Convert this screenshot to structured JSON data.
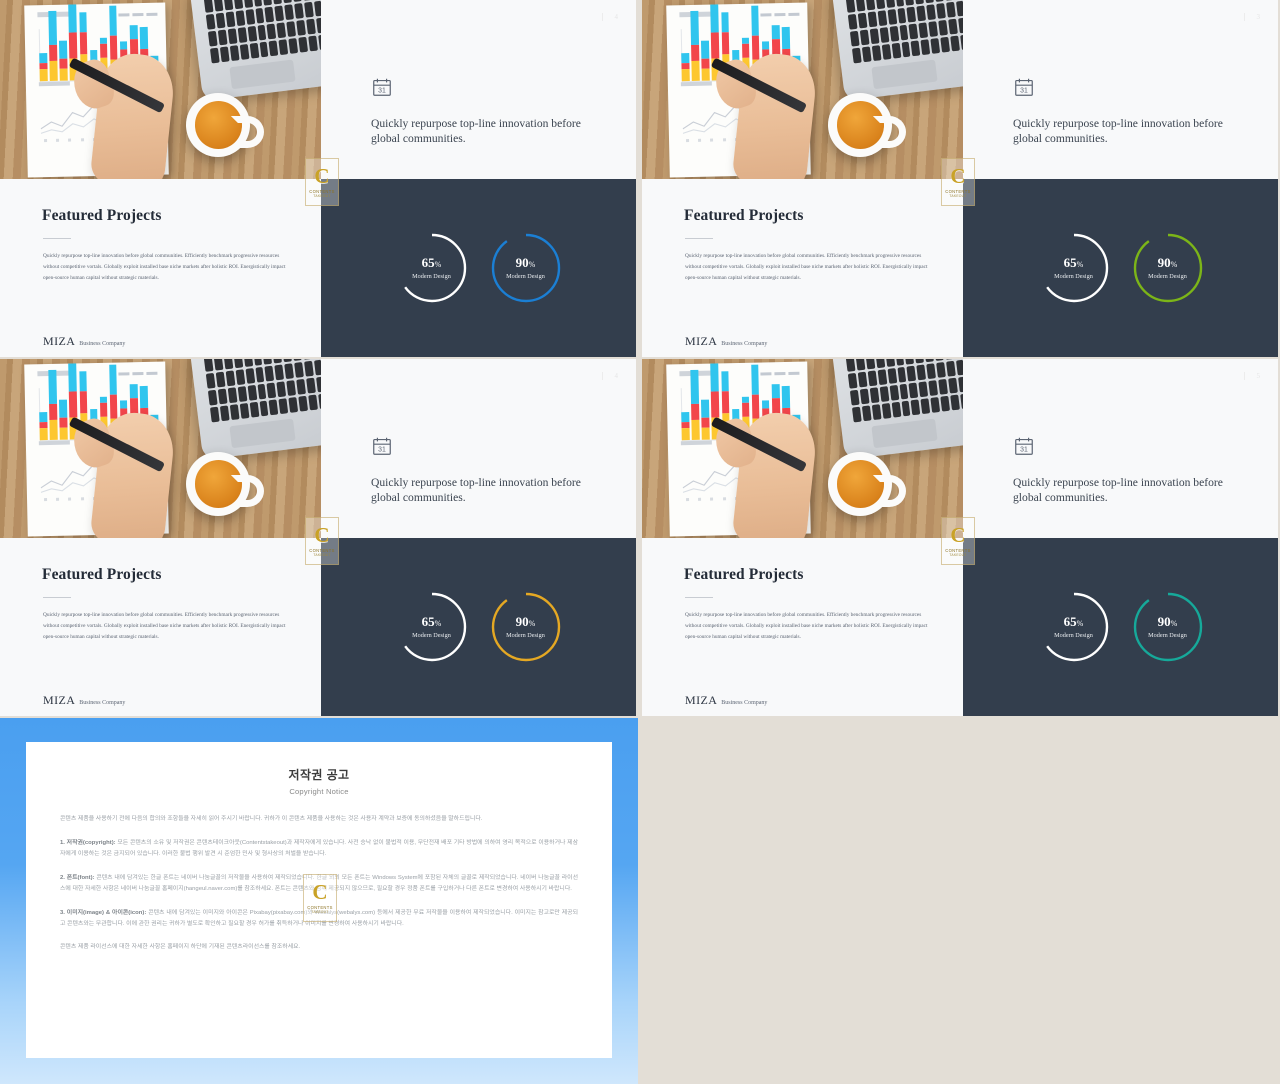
{
  "deck": {
    "slides": [
      {
        "page_number": "4",
        "accent": "#1b7fd4",
        "headline": "Quickly repurpose top-line innovation before global communities.",
        "section_title": "Featured Projects",
        "body": "Quickly repurpose top-line innovation before global communities. Efficiently benchmark progressive resources without competitive vortals. Globally exploit installed base niche markets after holistic ROI. Energistically impact open-source human capital without strategic materials.",
        "logo_mark": "MIZA",
        "logo_sub": "Business Company",
        "calendar_day": "31",
        "donuts": [
          {
            "value": 65,
            "value_label": "65",
            "unit": "%",
            "caption": "Modern Design",
            "color": "#ffffff"
          },
          {
            "value": 90,
            "value_label": "90",
            "unit": "%",
            "caption": "Modern Design",
            "color": "#1b7fd4"
          }
        ]
      },
      {
        "page_number": "3",
        "accent": "#7cb518",
        "headline": "Quickly repurpose top-line innovation before global communities.",
        "section_title": "Featured Projects",
        "body": "Quickly repurpose top-line innovation before global communities. Efficiently benchmark progressive resources without competitive vortals. Globally exploit installed base niche markets after holistic ROI. Energistically impact open-source human capital without strategic materials.",
        "logo_mark": "MIZA",
        "logo_sub": "Business Company",
        "calendar_day": "31",
        "donuts": [
          {
            "value": 65,
            "value_label": "65",
            "unit": "%",
            "caption": "Modern Design",
            "color": "#ffffff"
          },
          {
            "value": 90,
            "value_label": "90",
            "unit": "%",
            "caption": "Modern Design",
            "color": "#7cb518"
          }
        ]
      },
      {
        "page_number": "4",
        "accent": "#e5a823",
        "headline": "Quickly repurpose top-line innovation before global communities.",
        "section_title": "Featured Projects",
        "body": "Quickly repurpose top-line innovation before global communities. Efficiently benchmark progressive resources without competitive vortals. Globally exploit installed base niche markets after holistic ROI. Energistically impact open-source human capital without strategic materials.",
        "logo_mark": "MIZA",
        "logo_sub": "Business Company",
        "calendar_day": "31",
        "donuts": [
          {
            "value": 65,
            "value_label": "65",
            "unit": "%",
            "caption": "Modern Design",
            "color": "#ffffff"
          },
          {
            "value": 90,
            "value_label": "90",
            "unit": "%",
            "caption": "Modern Design",
            "color": "#e5a823"
          }
        ]
      },
      {
        "page_number": "5",
        "accent": "#16a99a",
        "headline": "Quickly repurpose top-line innovation before global communities.",
        "section_title": "Featured Projects",
        "body": "Quickly repurpose top-line innovation before global communities. Efficiently benchmark progressive resources without competitive vortals. Globally exploit installed base niche markets after holistic ROI. Energistically impact open-source human capital without strategic materials.",
        "logo_mark": "MIZA",
        "logo_sub": "Business Company",
        "calendar_day": "31",
        "donuts": [
          {
            "value": 65,
            "value_label": "65",
            "unit": "%",
            "caption": "Modern Design",
            "color": "#ffffff"
          },
          {
            "value": 90,
            "value_label": "90",
            "unit": "%",
            "caption": "Modern Design",
            "color": "#16a99a"
          }
        ]
      }
    ]
  },
  "watermark": {
    "glyph": "C",
    "line1": "CONTENTS",
    "line2": "TAKEOUT"
  },
  "copyright": {
    "title_ko": "저작권 공고",
    "title_en": "Copyright Notice",
    "intro": "콘텐츠 제품을 사용하기 전에 다음의 합의와 조항들을 자세히 읽어 주시기 바랍니다. 귀하가 이 콘텐츠 제품을 사용하는 것은 사용자 계약과 보증에 동의하셨음을 말하드립니다.",
    "p1_label": "1. 저작권(copyright):",
    "p1": "모든 콘텐츠의 소유 및 저작권은 콘텐츠테이크아웃(Contentstakeout)과 제작자에게 있습니다. 사전 승낙 없이 불법적 이용, 무단전재 배포 기타 방법에 의하여 영리 목적으로 이용하거나 제삼자에게 이용하는 것은 금지되어 있습니다. 이러한 불법 행위 발견 시 준엄한 민사 및 형사상의 처벌을 받습니다.",
    "p2_label": "2. 폰트(font):",
    "p2": "콘텐츠 내에 담겨있는 한글 폰트는 네이버 나눔글꼴의 저작물을 사용하여 제작되었습니다. 한글 외의 모든 폰트는 Windows System에 포함된 자체의 글꼴로 제작되었습니다. 네이버 나눔글꼴 라이선스에 대한 자세한 사항은 네이버 나눔글꼴 홈페이지(hangeul.naver.com)를 참조하세요. 폰트는 콘텐츠와 함께 제공되지 않으므로, 필요할 경우 정품 폰트를 구입하거나 다른 폰트로 변경하여 사용하시기 바랍니다.",
    "p3_label": "3. 이미지(image) & 아이콘(icon):",
    "p3": "콘텐츠 내에 담겨있는 이미지와 아이콘은 Pixabay(pixabay.com)와 Webalys(webalys.com) 등에서 제공한 무료 저작물을 이용하여 제작되었습니다. 이미지는 참고로만 제공되고 콘텐츠와는 무관합니다. 이에 관한 권리는 귀하가 별도로 확인하고 필요할 경우 허가를 취득하거나 이미지를 변경하여 사용하시기 바랍니다.",
    "footer": "콘텐츠 제품 라이선스에 대한 자세한 사항은 홈페이지 하단에 기재된 콘텐츠라이선스를 참조하세요."
  },
  "photo": {
    "alt": "desk-with-bar-chart-printout-hand-pen-coffee-laptop",
    "bar_chart": {
      "type": "bar",
      "stacked": true,
      "series": [
        {
          "name": "top",
          "color": "#30c5ee",
          "values": [
            10,
            34,
            18,
            40,
            20,
            14,
            6,
            30,
            8,
            14,
            22,
            13
          ]
        },
        {
          "name": "middle",
          "color": "#f2464b",
          "values": [
            6,
            16,
            10,
            26,
            22,
            6,
            14,
            24,
            12,
            26,
            18,
            4
          ]
        },
        {
          "name": "bottom",
          "color": "#fdc72f",
          "values": [
            12,
            20,
            12,
            22,
            26,
            10,
            22,
            20,
            18,
            14,
            12,
            6
          ]
        }
      ]
    },
    "line_chart": {
      "type": "line",
      "series": [
        {
          "name": "a"
        },
        {
          "name": "b"
        }
      ]
    }
  }
}
